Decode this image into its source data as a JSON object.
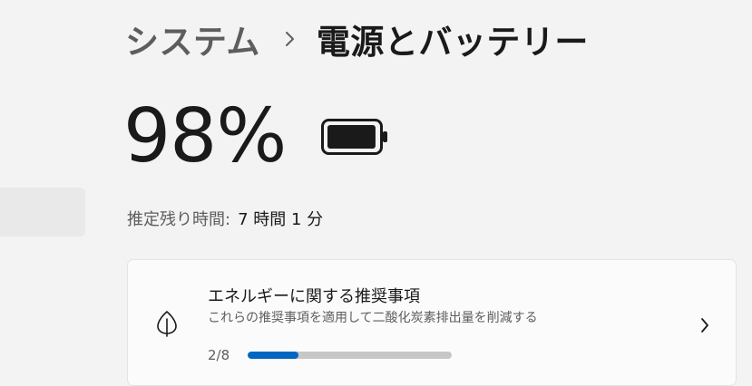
{
  "breadcrumb": {
    "parent": "システム",
    "current": "電源とバッテリー"
  },
  "battery": {
    "percent_text": "98%",
    "level_fraction": 0.98,
    "remaining_label": "推定残り時間:",
    "remaining_value": "7 時間 1 分"
  },
  "recommendations": {
    "title": "エネルギーに関する推奨事項",
    "subtitle": "これらの推奨事項を適用して二酸化炭素排出量を削減する",
    "progress_text": "2/8",
    "progress_fraction": 0.25
  },
  "icons": {
    "chevron_breadcrumb": "chevron-right-icon",
    "battery": "battery-full-icon",
    "leaf": "leaf-icon",
    "chevron_card": "chevron-right-icon"
  },
  "colors": {
    "accent": "#0067c0",
    "background": "#f3f3f3"
  }
}
